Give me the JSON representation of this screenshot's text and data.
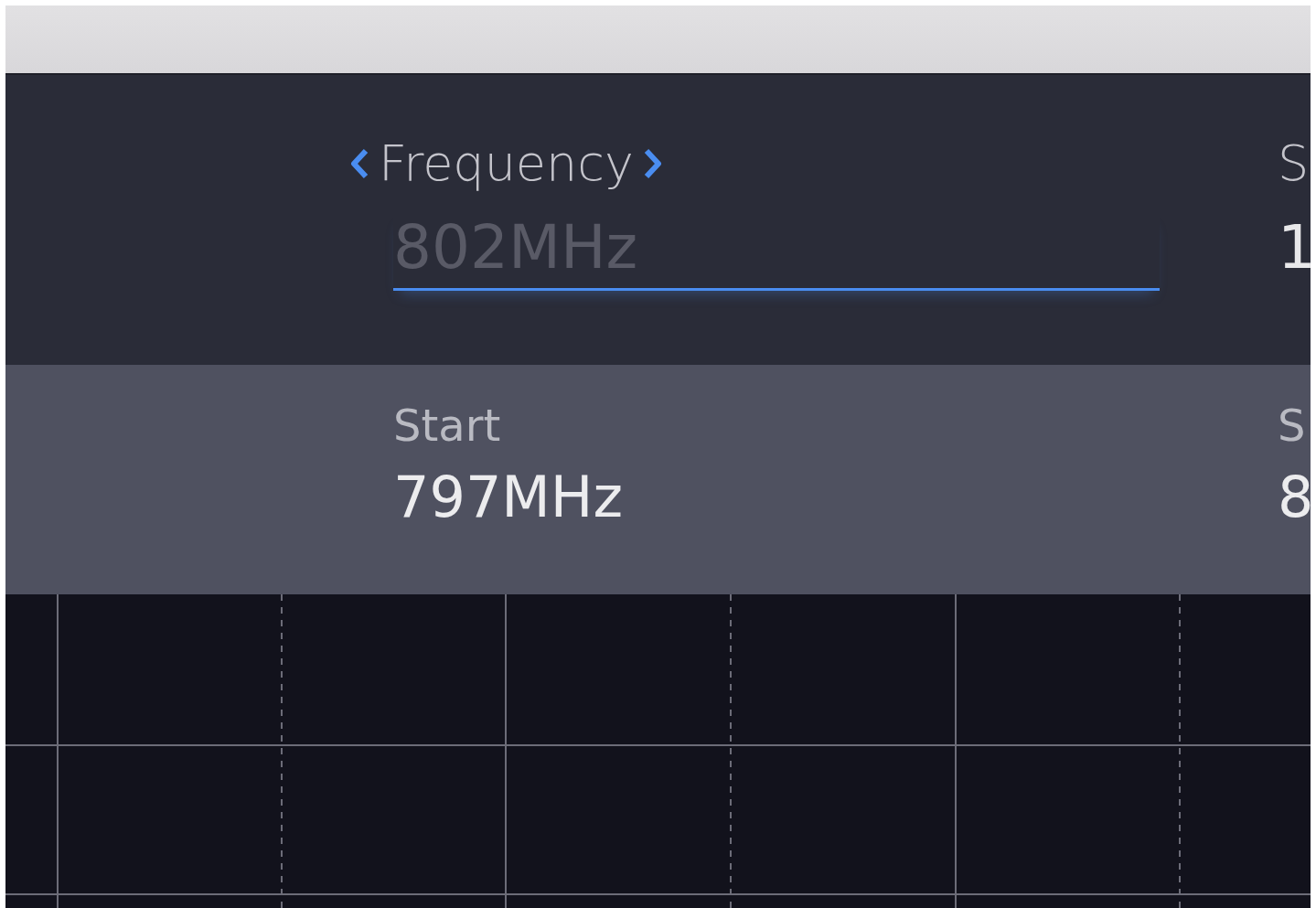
{
  "parameter": {
    "label": "Frequency",
    "placeholder": "802MHz",
    "focused": true
  },
  "parameter_2": {
    "label": "S",
    "value": "1"
  },
  "range": [
    {
      "label": "Start",
      "value": "797MHz"
    },
    {
      "label": "S",
      "value": "8"
    }
  ]
}
